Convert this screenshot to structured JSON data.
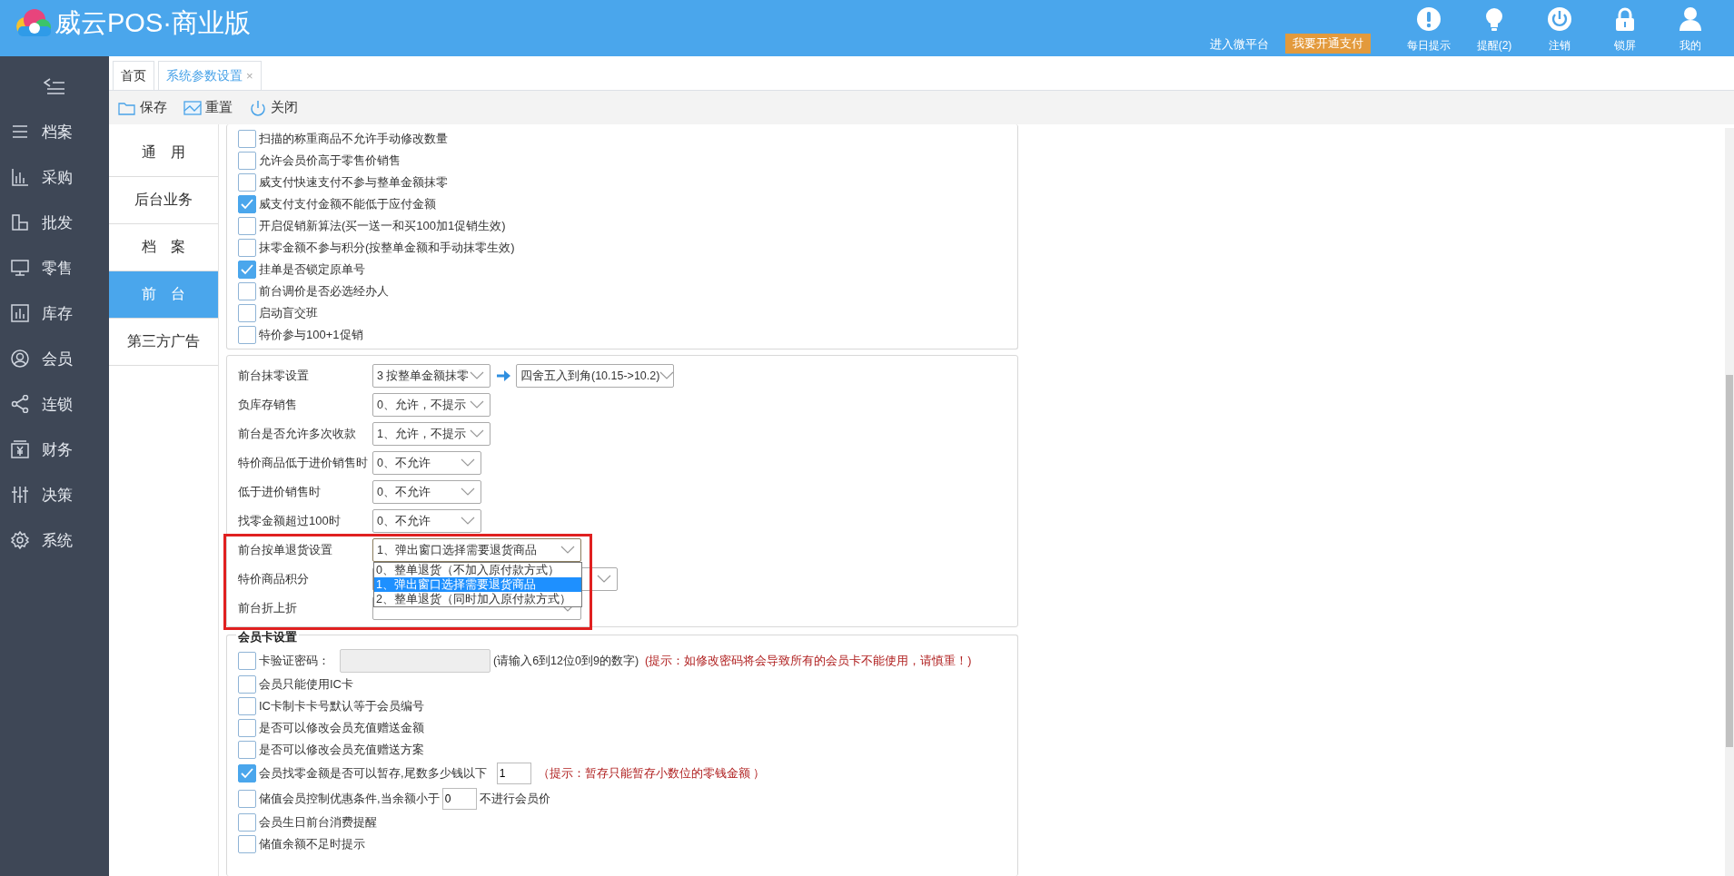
{
  "header": {
    "brand": "威云POS·商业版",
    "links": [
      {
        "label": "进入微平台"
      }
    ],
    "pay_button": "我要开通支付",
    "actions": [
      {
        "label": "每日提示"
      },
      {
        "label": "提醒(2)"
      },
      {
        "label": "注销"
      },
      {
        "label": "锁屏"
      },
      {
        "label": "我的"
      }
    ]
  },
  "sidebar": {
    "items": [
      {
        "label": "档案"
      },
      {
        "label": "采购"
      },
      {
        "label": "批发"
      },
      {
        "label": "零售"
      },
      {
        "label": "库存"
      },
      {
        "label": "会员"
      },
      {
        "label": "连锁"
      },
      {
        "label": "财务"
      },
      {
        "label": "决策"
      },
      {
        "label": "系统"
      }
    ]
  },
  "tabs": [
    {
      "label": "首页",
      "selected": false,
      "closable": false
    },
    {
      "label": "系统参数设置",
      "selected": true,
      "closable": true,
      "close_label": "×"
    }
  ],
  "toolbar": [
    {
      "label": "保存"
    },
    {
      "label": "重置"
    },
    {
      "label": "关闭"
    }
  ],
  "settings_nav": [
    {
      "label": "通　用",
      "selected": false
    },
    {
      "label": "后台业务",
      "selected": false
    },
    {
      "label": "档　案",
      "selected": false
    },
    {
      "label": "前　台",
      "selected": true
    },
    {
      "label": "第三方广告",
      "selected": false
    }
  ],
  "options": [
    {
      "label": "扫描的称重商品不允许手动修改数量",
      "checked": false
    },
    {
      "label": "允许会员价高于零售价销售",
      "checked": false
    },
    {
      "label": "威支付快速支付不参与整单金额抹零",
      "checked": false
    },
    {
      "label": "威支付支付金额不能低于应付金额",
      "checked": true
    },
    {
      "label": "开启促销新算法(买一送一和买100加1促销生效)",
      "checked": false
    },
    {
      "label": "抹零金额不参与积分(按整单金额和手动抹零生效)",
      "checked": false
    },
    {
      "label": "挂单是否锁定原单号",
      "checked": true
    },
    {
      "label": "前台调价是否必选经办人",
      "checked": false
    },
    {
      "label": "启动盲交班",
      "checked": false
    },
    {
      "label": "特价参与100+1促销",
      "checked": false
    }
  ],
  "selects": [
    {
      "label": "前台抹零设置",
      "value": "3 按整单金额抹零",
      "extra_value": "四舍五入到角(10.15->10.2)"
    },
    {
      "label": "负库存销售",
      "value": "0、允许，不提示"
    },
    {
      "label": "前台是否允许多次收款",
      "value": "1、允许，不提示"
    },
    {
      "label": "特价商品低于进价销售时",
      "value": "0、不允许"
    },
    {
      "label": "低于进价销售时",
      "value": "0、不允许"
    },
    {
      "label": "找零金额超过100时",
      "value": "0、不允许"
    },
    {
      "label": "前台按单退货设置",
      "value": "1、弹出窗口选择需要退货商品",
      "expanded": true,
      "options": [
        {
          "label": "0、整单退货（不加入原付款方式）",
          "selected": false
        },
        {
          "label": "1、弹出窗口选择需要退货商品",
          "selected": true
        },
        {
          "label": "2、整单退货（同时加入原付款方式）",
          "selected": false
        }
      ]
    },
    {
      "label": "特价商品积分"
    },
    {
      "label": "前台折上折"
    }
  ],
  "member_card": {
    "title": "会员卡设置",
    "items": [
      {
        "label": "卡验证密码：",
        "checked": false,
        "kind": "password",
        "note": "(请输入6到12位0到9的数字)",
        "warning": "(提示：如修改密码将会导致所有的会员卡不能使用，请慎重！)"
      },
      {
        "label": "会员只能使用IC卡",
        "checked": false,
        "kind": "plain"
      },
      {
        "label": "IC卡制卡卡号默认等于会员编号",
        "checked": false,
        "kind": "plain"
      },
      {
        "label": "是否可以修改会员充值赠送金额",
        "checked": false,
        "kind": "plain"
      },
      {
        "label": "是否可以修改会员充值赠送方案",
        "checked": false,
        "kind": "plain"
      },
      {
        "label": "会员找零金额是否可以暂存,尾数多少钱以下",
        "checked": true,
        "kind": "amount",
        "value": "1",
        "warning": "（提示：暂存只能暂存小数位的零钱金额 ）"
      },
      {
        "label": "储值会员控制优惠条件,当余额小于",
        "checked": false,
        "kind": "amount",
        "value": "0",
        "suffix": "不进行会员价"
      },
      {
        "label": "会员生日前台消费提醒",
        "checked": false,
        "kind": "plain"
      },
      {
        "label": "储值余额不足时提示",
        "checked": false,
        "kind": "plain"
      }
    ]
  }
}
